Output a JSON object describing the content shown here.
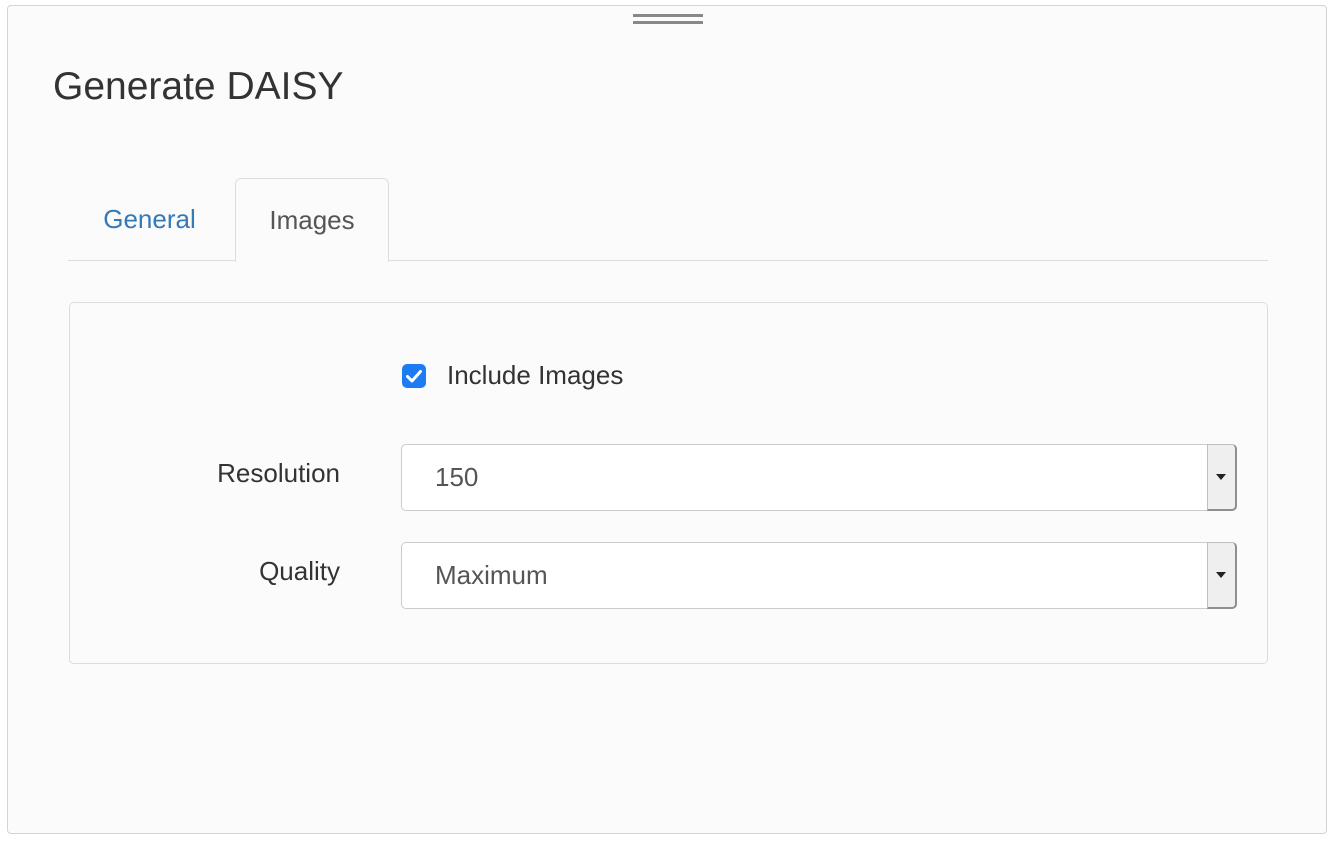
{
  "dialog": {
    "title": "Generate DAISY"
  },
  "tabs": [
    {
      "label": "General",
      "active": false
    },
    {
      "label": "Images",
      "active": true
    }
  ],
  "images_panel": {
    "include_images": {
      "label": "Include Images",
      "checked": true
    },
    "resolution": {
      "label": "Resolution",
      "value": "150"
    },
    "quality": {
      "label": "Quality",
      "value": "Maximum"
    }
  },
  "colors": {
    "accent": "#1e7cf2",
    "link": "#337ab7",
    "text": "#333333"
  },
  "icons": {
    "checkbox": "checkmark-icon",
    "select_arrow": "caret-down-icon",
    "drag": "drag-handle-icon"
  }
}
